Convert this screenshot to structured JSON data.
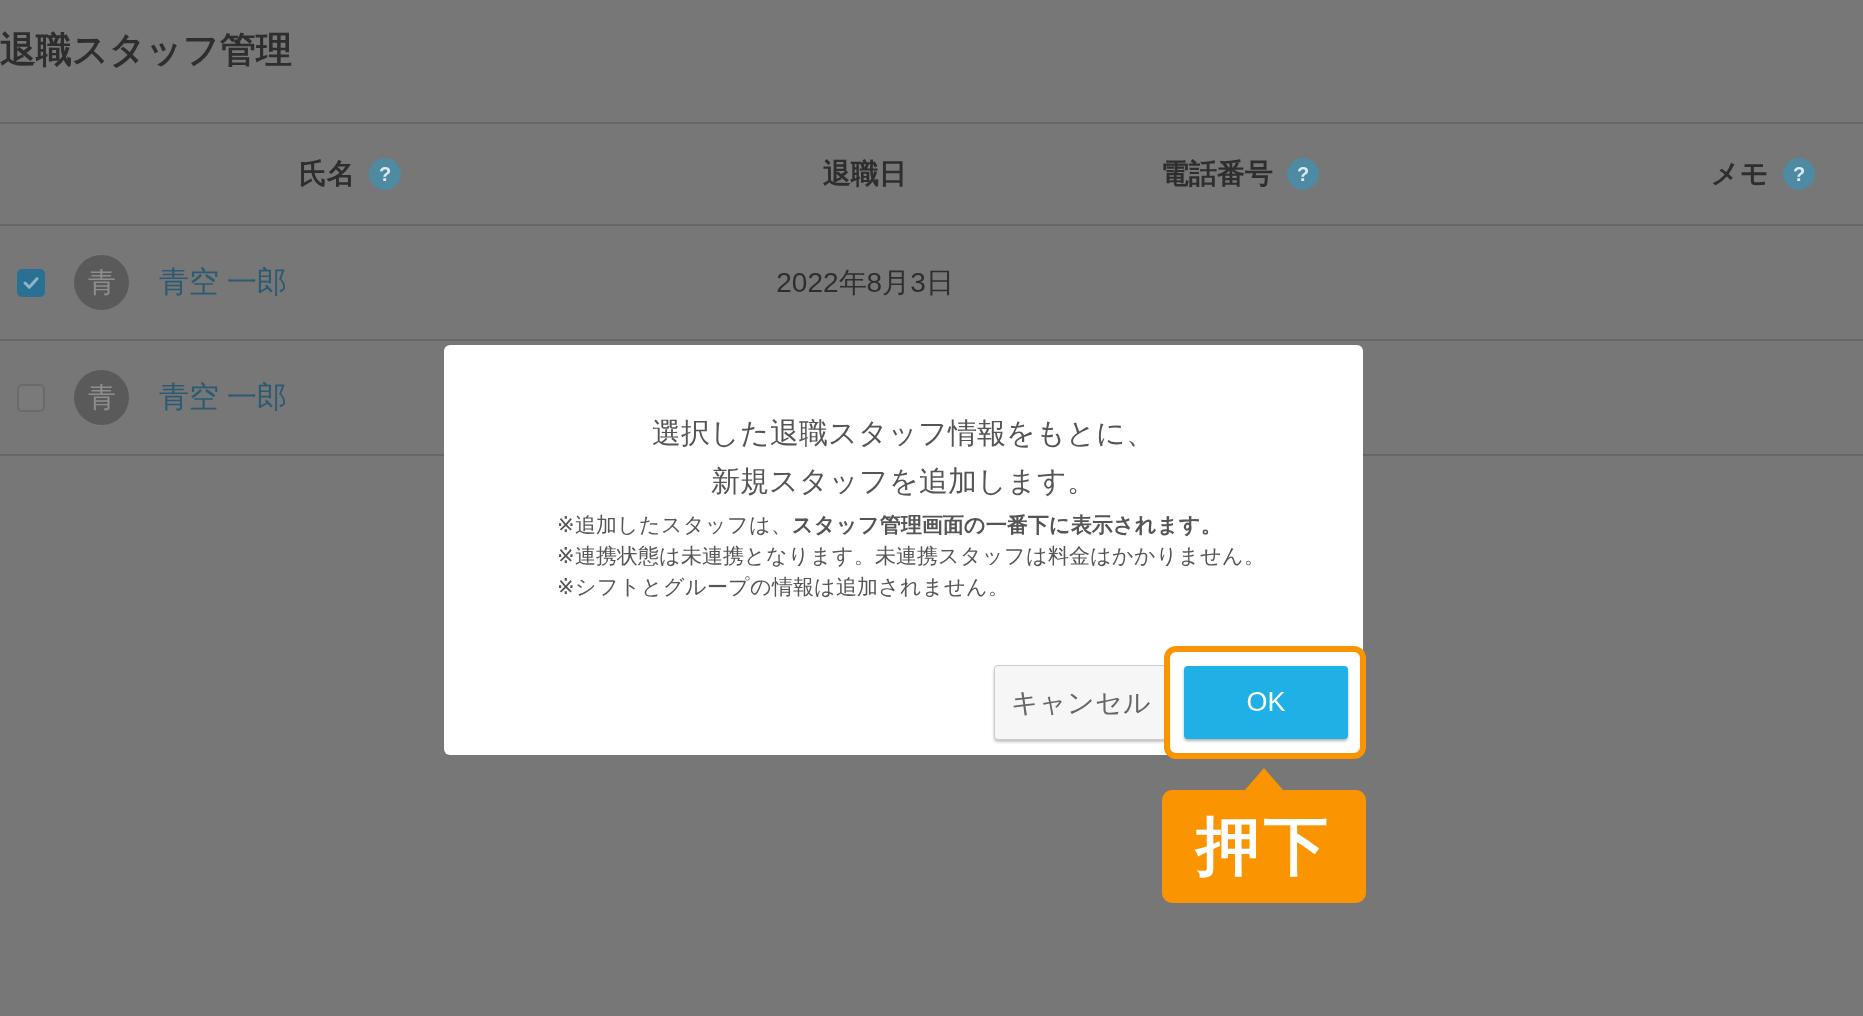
{
  "page": {
    "title": "退職スタッフ管理"
  },
  "table": {
    "columns": [
      {
        "label": "氏名",
        "help": "?"
      },
      {
        "label": "退職日"
      },
      {
        "label": "電話番号",
        "help": "?"
      },
      {
        "label": "メモ",
        "help": "?"
      }
    ],
    "rows": [
      {
        "checked": true,
        "avatar": "青",
        "name": "青空 一郎",
        "retired_on": "2022年8月3日"
      },
      {
        "checked": false,
        "avatar": "青",
        "name": "青空 一郎"
      }
    ]
  },
  "dialog": {
    "message_lines": [
      "選択した退職スタッフ情報をもとに、",
      "新規スタッフを追加します。"
    ],
    "notes": [
      "※追加したスタッフは、**スタッフ管理画面の一番下に表示されます。**",
      "※連携状態は未連携となります。未連携スタッフは料金はかかりません。",
      "※シフトとグループの情報は追加されません。"
    ],
    "buttons": [
      {
        "label": "キャンセル",
        "kind": "secondary",
        "highlighted": false
      },
      {
        "label": "OK",
        "kind": "primary",
        "highlighted": true
      }
    ]
  },
  "annotation": {
    "callout": "押下"
  }
}
